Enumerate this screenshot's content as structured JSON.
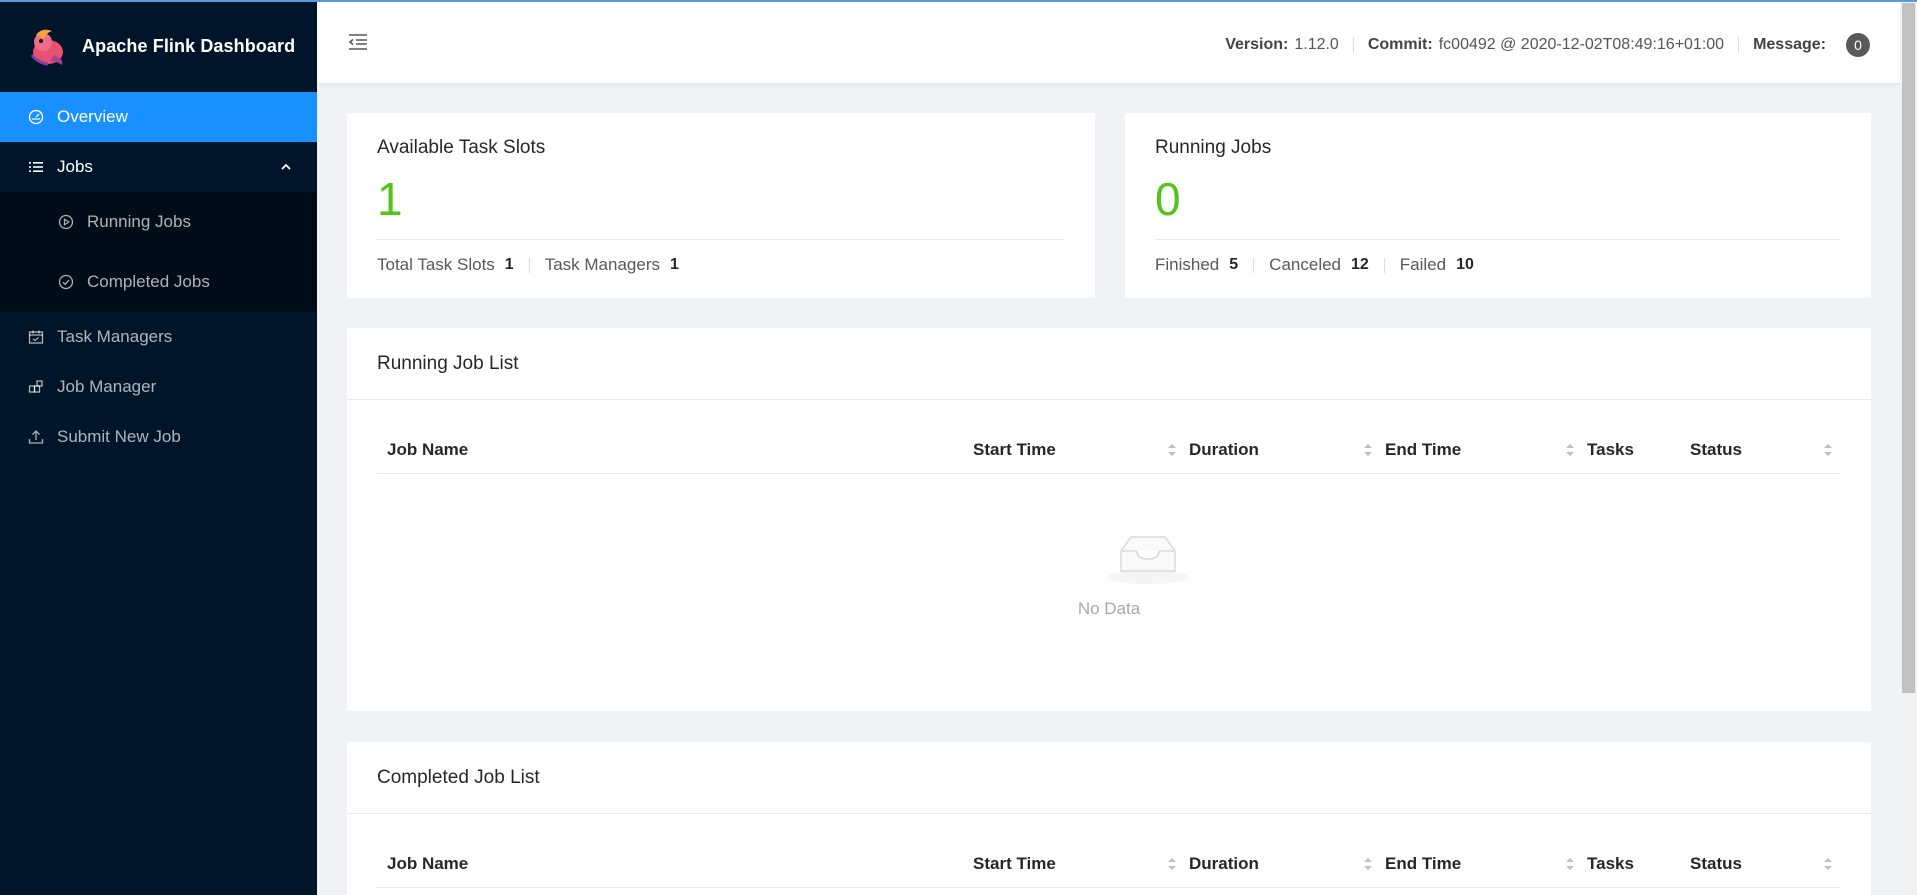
{
  "app": {
    "title": "Apache Flink Dashboard"
  },
  "sidebar": {
    "items": [
      {
        "label": "Overview",
        "icon": "dashboard-icon"
      },
      {
        "label": "Jobs",
        "icon": "list-icon"
      },
      {
        "label": "Running Jobs",
        "icon": "play-circle-icon"
      },
      {
        "label": "Completed Jobs",
        "icon": "check-circle-icon"
      },
      {
        "label": "Task Managers",
        "icon": "schedule-icon"
      },
      {
        "label": "Job Manager",
        "icon": "build-icon"
      },
      {
        "label": "Submit New Job",
        "icon": "upload-icon"
      }
    ]
  },
  "header": {
    "version_label": "Version:",
    "version": "1.12.0",
    "commit_label": "Commit:",
    "commit": "fc00492 @ 2020-12-02T08:49:16+01:00",
    "message_label": "Message:",
    "message_count": "0"
  },
  "slots": {
    "title": "Available Task Slots",
    "value": "1",
    "total_label": "Total Task Slots",
    "total": "1",
    "tm_label": "Task Managers",
    "tm": "1"
  },
  "running": {
    "title": "Running Jobs",
    "value": "0",
    "finished_label": "Finished",
    "finished": "5",
    "canceled_label": "Canceled",
    "canceled": "12",
    "failed_label": "Failed",
    "failed": "10"
  },
  "running_list": {
    "title": "Running Job List",
    "columns": [
      "Job Name",
      "Start Time",
      "Duration",
      "End Time",
      "Tasks",
      "Status"
    ],
    "empty_text": "No Data"
  },
  "completed_list": {
    "title": "Completed Job List",
    "columns": [
      "Job Name",
      "Start Time",
      "Duration",
      "End Time",
      "Tasks",
      "Status"
    ]
  },
  "colors": {
    "accent": "#1890ff",
    "sider": "#001529",
    "success": "#52c41a"
  }
}
